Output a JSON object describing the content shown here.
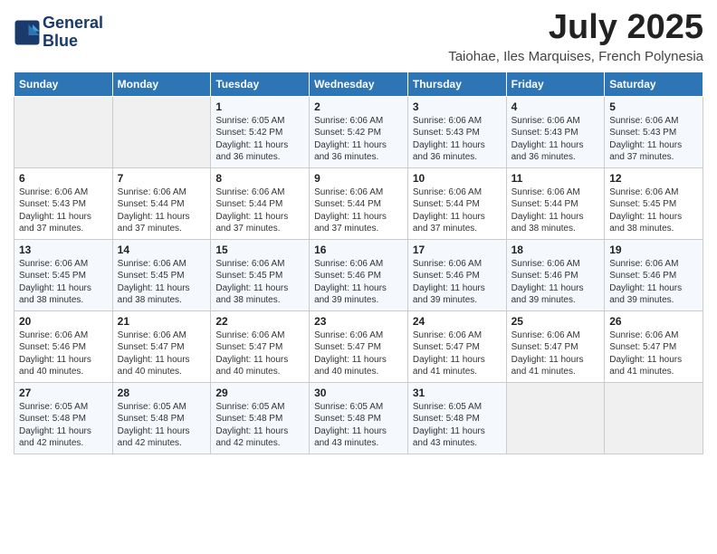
{
  "header": {
    "logo_line1": "General",
    "logo_line2": "Blue",
    "month": "July 2025",
    "location": "Taiohae, Iles Marquises, French Polynesia"
  },
  "days_of_week": [
    "Sunday",
    "Monday",
    "Tuesday",
    "Wednesday",
    "Thursday",
    "Friday",
    "Saturday"
  ],
  "weeks": [
    [
      {
        "day": "",
        "text": ""
      },
      {
        "day": "",
        "text": ""
      },
      {
        "day": "1",
        "text": "Sunrise: 6:05 AM\nSunset: 5:42 PM\nDaylight: 11 hours and 36 minutes."
      },
      {
        "day": "2",
        "text": "Sunrise: 6:06 AM\nSunset: 5:42 PM\nDaylight: 11 hours and 36 minutes."
      },
      {
        "day": "3",
        "text": "Sunrise: 6:06 AM\nSunset: 5:43 PM\nDaylight: 11 hours and 36 minutes."
      },
      {
        "day": "4",
        "text": "Sunrise: 6:06 AM\nSunset: 5:43 PM\nDaylight: 11 hours and 36 minutes."
      },
      {
        "day": "5",
        "text": "Sunrise: 6:06 AM\nSunset: 5:43 PM\nDaylight: 11 hours and 37 minutes."
      }
    ],
    [
      {
        "day": "6",
        "text": "Sunrise: 6:06 AM\nSunset: 5:43 PM\nDaylight: 11 hours and 37 minutes."
      },
      {
        "day": "7",
        "text": "Sunrise: 6:06 AM\nSunset: 5:44 PM\nDaylight: 11 hours and 37 minutes."
      },
      {
        "day": "8",
        "text": "Sunrise: 6:06 AM\nSunset: 5:44 PM\nDaylight: 11 hours and 37 minutes."
      },
      {
        "day": "9",
        "text": "Sunrise: 6:06 AM\nSunset: 5:44 PM\nDaylight: 11 hours and 37 minutes."
      },
      {
        "day": "10",
        "text": "Sunrise: 6:06 AM\nSunset: 5:44 PM\nDaylight: 11 hours and 37 minutes."
      },
      {
        "day": "11",
        "text": "Sunrise: 6:06 AM\nSunset: 5:44 PM\nDaylight: 11 hours and 38 minutes."
      },
      {
        "day": "12",
        "text": "Sunrise: 6:06 AM\nSunset: 5:45 PM\nDaylight: 11 hours and 38 minutes."
      }
    ],
    [
      {
        "day": "13",
        "text": "Sunrise: 6:06 AM\nSunset: 5:45 PM\nDaylight: 11 hours and 38 minutes."
      },
      {
        "day": "14",
        "text": "Sunrise: 6:06 AM\nSunset: 5:45 PM\nDaylight: 11 hours and 38 minutes."
      },
      {
        "day": "15",
        "text": "Sunrise: 6:06 AM\nSunset: 5:45 PM\nDaylight: 11 hours and 38 minutes."
      },
      {
        "day": "16",
        "text": "Sunrise: 6:06 AM\nSunset: 5:46 PM\nDaylight: 11 hours and 39 minutes."
      },
      {
        "day": "17",
        "text": "Sunrise: 6:06 AM\nSunset: 5:46 PM\nDaylight: 11 hours and 39 minutes."
      },
      {
        "day": "18",
        "text": "Sunrise: 6:06 AM\nSunset: 5:46 PM\nDaylight: 11 hours and 39 minutes."
      },
      {
        "day": "19",
        "text": "Sunrise: 6:06 AM\nSunset: 5:46 PM\nDaylight: 11 hours and 39 minutes."
      }
    ],
    [
      {
        "day": "20",
        "text": "Sunrise: 6:06 AM\nSunset: 5:46 PM\nDaylight: 11 hours and 40 minutes."
      },
      {
        "day": "21",
        "text": "Sunrise: 6:06 AM\nSunset: 5:47 PM\nDaylight: 11 hours and 40 minutes."
      },
      {
        "day": "22",
        "text": "Sunrise: 6:06 AM\nSunset: 5:47 PM\nDaylight: 11 hours and 40 minutes."
      },
      {
        "day": "23",
        "text": "Sunrise: 6:06 AM\nSunset: 5:47 PM\nDaylight: 11 hours and 40 minutes."
      },
      {
        "day": "24",
        "text": "Sunrise: 6:06 AM\nSunset: 5:47 PM\nDaylight: 11 hours and 41 minutes."
      },
      {
        "day": "25",
        "text": "Sunrise: 6:06 AM\nSunset: 5:47 PM\nDaylight: 11 hours and 41 minutes."
      },
      {
        "day": "26",
        "text": "Sunrise: 6:06 AM\nSunset: 5:47 PM\nDaylight: 11 hours and 41 minutes."
      }
    ],
    [
      {
        "day": "27",
        "text": "Sunrise: 6:05 AM\nSunset: 5:48 PM\nDaylight: 11 hours and 42 minutes."
      },
      {
        "day": "28",
        "text": "Sunrise: 6:05 AM\nSunset: 5:48 PM\nDaylight: 11 hours and 42 minutes."
      },
      {
        "day": "29",
        "text": "Sunrise: 6:05 AM\nSunset: 5:48 PM\nDaylight: 11 hours and 42 minutes."
      },
      {
        "day": "30",
        "text": "Sunrise: 6:05 AM\nSunset: 5:48 PM\nDaylight: 11 hours and 43 minutes."
      },
      {
        "day": "31",
        "text": "Sunrise: 6:05 AM\nSunset: 5:48 PM\nDaylight: 11 hours and 43 minutes."
      },
      {
        "day": "",
        "text": ""
      },
      {
        "day": "",
        "text": ""
      }
    ]
  ]
}
